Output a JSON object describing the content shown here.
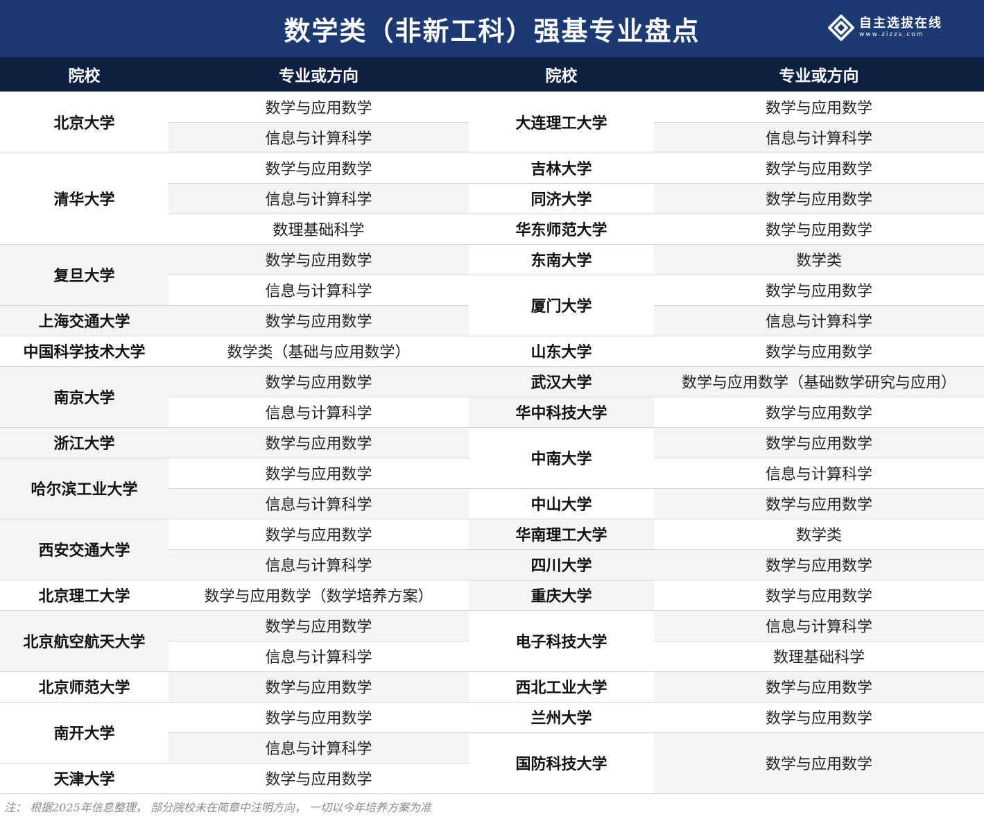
{
  "title": "数学类（非新工科）强基专业盘点",
  "logo": {
    "name": "自主选拔在线",
    "url": "www.zizzs.com"
  },
  "headers": {
    "school": "院校",
    "major": "专业或方向"
  },
  "left": [
    {
      "school": "北京大学",
      "majors": [
        "数学与应用数学",
        "信息与计算科学"
      ]
    },
    {
      "school": "清华大学",
      "majors": [
        "数学与应用数学",
        "信息与计算科学",
        "数理基础科学"
      ]
    },
    {
      "school": "复旦大学",
      "majors": [
        "数学与应用数学",
        "信息与计算科学"
      ]
    },
    {
      "school": "上海交通大学",
      "majors": [
        "数学与应用数学"
      ]
    },
    {
      "school": "中国科学技术大学",
      "majors": [
        "数学类（基础与应用数学）"
      ]
    },
    {
      "school": "南京大学",
      "majors": [
        "数学与应用数学",
        "信息与计算科学"
      ]
    },
    {
      "school": "浙江大学",
      "majors": [
        "数学与应用数学"
      ]
    },
    {
      "school": "哈尔滨工业大学",
      "majors": [
        "数学与应用数学",
        "信息与计算科学"
      ]
    },
    {
      "school": "西安交通大学",
      "majors": [
        "数学与应用数学",
        "信息与计算科学"
      ]
    },
    {
      "school": "北京理工大学",
      "majors": [
        "数学与应用数学（数学培养方案）"
      ]
    },
    {
      "school": "北京航空航天大学",
      "majors": [
        "数学与应用数学",
        "信息与计算科学"
      ]
    },
    {
      "school": "北京师范大学",
      "majors": [
        "数学与应用数学"
      ]
    },
    {
      "school": "南开大学",
      "majors": [
        "数学与应用数学",
        "信息与计算科学"
      ]
    },
    {
      "school": "天津大学",
      "majors": [
        "数学与应用数学"
      ]
    }
  ],
  "right": [
    {
      "school": "大连理工大学",
      "majors": [
        "数学与应用数学",
        "信息与计算科学"
      ]
    },
    {
      "school": "吉林大学",
      "majors": [
        "数学与应用数学"
      ]
    },
    {
      "school": "同济大学",
      "majors": [
        "数学与应用数学"
      ]
    },
    {
      "school": "华东师范大学",
      "majors": [
        "数学与应用数学"
      ]
    },
    {
      "school": "东南大学",
      "majors": [
        "数学类"
      ]
    },
    {
      "school": "厦门大学",
      "majors": [
        "数学与应用数学",
        "信息与计算科学"
      ]
    },
    {
      "school": "山东大学",
      "majors": [
        "数学与应用数学"
      ]
    },
    {
      "school": "武汉大学",
      "majors": [
        "数学与应用数学（基础数学研究与应用）"
      ]
    },
    {
      "school": "华中科技大学",
      "majors": [
        "数学与应用数学"
      ]
    },
    {
      "school": "中南大学",
      "majors": [
        "数学与应用数学",
        "信息与计算科学"
      ]
    },
    {
      "school": "中山大学",
      "majors": [
        "数学与应用数学"
      ]
    },
    {
      "school": "华南理工大学",
      "majors": [
        "数学类"
      ]
    },
    {
      "school": "四川大学",
      "majors": [
        "数学与应用数学"
      ]
    },
    {
      "school": "重庆大学",
      "majors": [
        "数学与应用数学"
      ]
    },
    {
      "school": "电子科技大学",
      "majors": [
        "信息与计算科学",
        "数理基础科学"
      ]
    },
    {
      "school": "西北工业大学",
      "majors": [
        "数学与应用数学"
      ]
    },
    {
      "school": "兰州大学",
      "majors": [
        "数学与应用数学"
      ]
    },
    {
      "school": "国防科技大学",
      "majors": [
        "数学与应用数学"
      ]
    }
  ],
  "note": "注：  根据2025年信息整理，  部分院校未在简章中注明方向，  一切以今年培养方案为准"
}
